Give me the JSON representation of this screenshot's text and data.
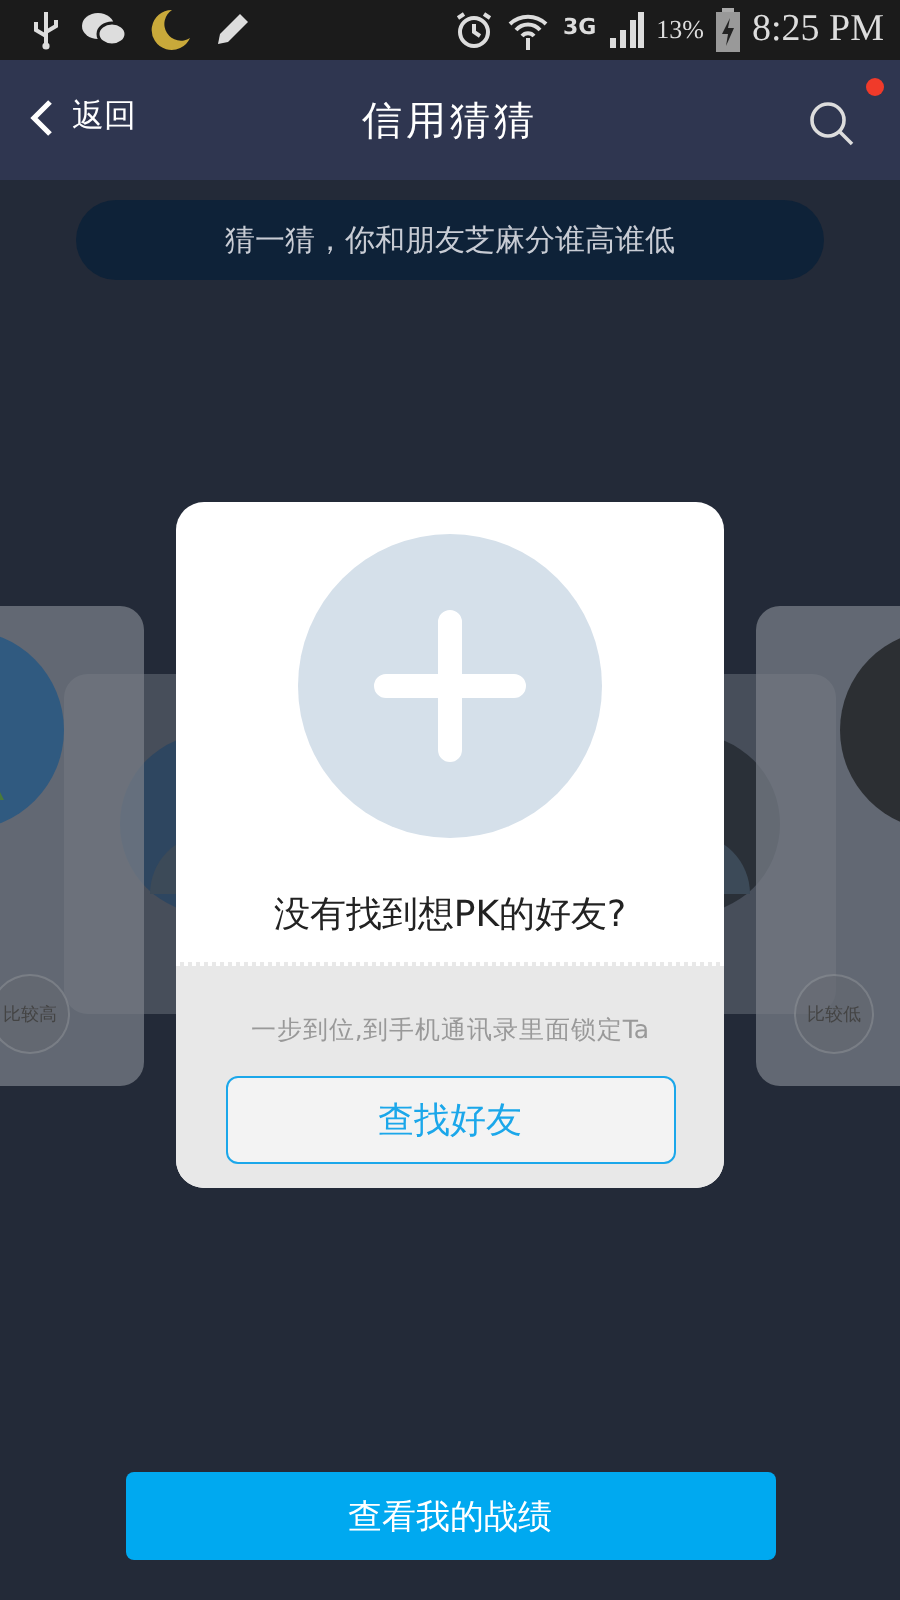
{
  "status_bar": {
    "network": "3G",
    "battery": "13%",
    "time": "8:25 PM"
  },
  "nav": {
    "back": "返回",
    "title": "信用猜猜",
    "search_badge": true
  },
  "banner": "猜一猜，你和朋友芝麻分谁高谁低",
  "cards": [
    {
      "kind": "left",
      "label": "比较高"
    },
    {
      "kind": "right",
      "label": "比较低"
    }
  ],
  "dialog": {
    "title": "没有找到想PK的好友?",
    "hint": "一步到位,到手机通讯录里面锁定Ta",
    "button": "查找好友"
  },
  "bottom_button": "查看我的战绩"
}
